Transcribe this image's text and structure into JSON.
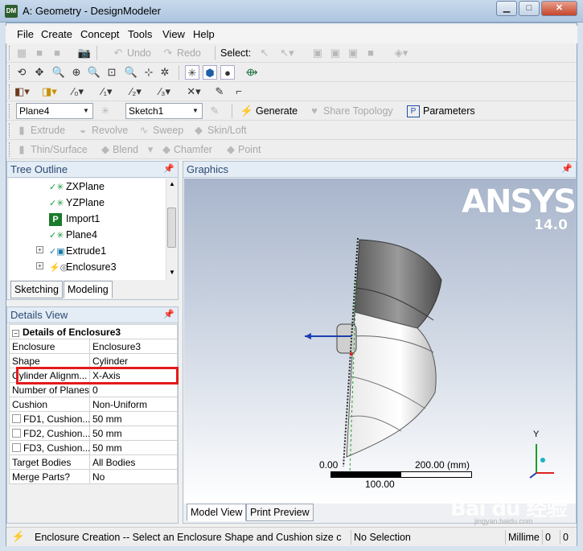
{
  "window": {
    "title": "A: Geometry - DesignModeler",
    "app_icon": "DM"
  },
  "menu": [
    "File",
    "Create",
    "Concept",
    "Tools",
    "View",
    "Help"
  ],
  "toolbar1": {
    "undo": "Undo",
    "redo": "Redo",
    "select": "Select:"
  },
  "toolbar4": {
    "plane_value": "Plane4",
    "sketch_value": "Sketch1",
    "generate": "Generate",
    "share_topology": "Share Topology",
    "parameters": "Parameters"
  },
  "toolbar5": {
    "extrude": "Extrude",
    "revolve": "Revolve",
    "sweep": "Sweep",
    "skin_loft": "Skin/Loft"
  },
  "toolbar6": {
    "thin_surface": "Thin/Surface",
    "blend": "Blend",
    "chamfer": "Chamfer",
    "point": "Point"
  },
  "tree": {
    "title": "Tree Outline",
    "items": [
      {
        "label": "ZXPlane",
        "icon": "plane-icon"
      },
      {
        "label": "YZPlane",
        "icon": "plane-icon"
      },
      {
        "label": "Import1",
        "icon": "import-icon"
      },
      {
        "label": "Plane4",
        "icon": "plane-icon"
      },
      {
        "label": "Extrude1",
        "icon": "extrude-icon"
      },
      {
        "label": "Enclosure3",
        "icon": "enclosure-icon"
      }
    ],
    "tabs": [
      "Sketching",
      "Modeling"
    ]
  },
  "details": {
    "title": "Details View",
    "header": "Details of Enclosure3",
    "rows": [
      {
        "name": "Enclosure",
        "value": "Enclosure3"
      },
      {
        "name": "Shape",
        "value": "Cylinder"
      },
      {
        "name": "Cylinder Alignm...",
        "value": "X-Axis"
      },
      {
        "name": "Number of Planes",
        "value": "0"
      },
      {
        "name": "Cushion",
        "value": "Non-Uniform"
      },
      {
        "name": "FD1, Cushion...",
        "value": "50 mm"
      },
      {
        "name": "FD2, Cushion...",
        "value": "50 mm"
      },
      {
        "name": "FD3, Cushion...",
        "value": "50 mm"
      },
      {
        "name": "Target Bodies",
        "value": "All Bodies"
      },
      {
        "name": "Merge Parts?",
        "value": "No"
      }
    ]
  },
  "graphics": {
    "title": "Graphics",
    "logo": "ANSYS",
    "version": "14.0",
    "scale": {
      "start": "0.00",
      "end": "200.00 (mm)",
      "mid": "100.00"
    },
    "axis_label": "Y",
    "tabs": [
      "Model View",
      "Print Preview"
    ]
  },
  "status": {
    "message": "Enclosure Creation -- Select an Enclosure Shape and Cushion size c",
    "selection": "No Selection",
    "units": "Millime",
    "v1": "0",
    "v2": "0"
  },
  "watermark": {
    "text": "Bai du 经验",
    "sub": "jingyan.baidu.com"
  },
  "colors": {
    "highlight": "#e21b1b",
    "title_bg": "#aec6e0",
    "panel_header": "#2a4b72"
  }
}
